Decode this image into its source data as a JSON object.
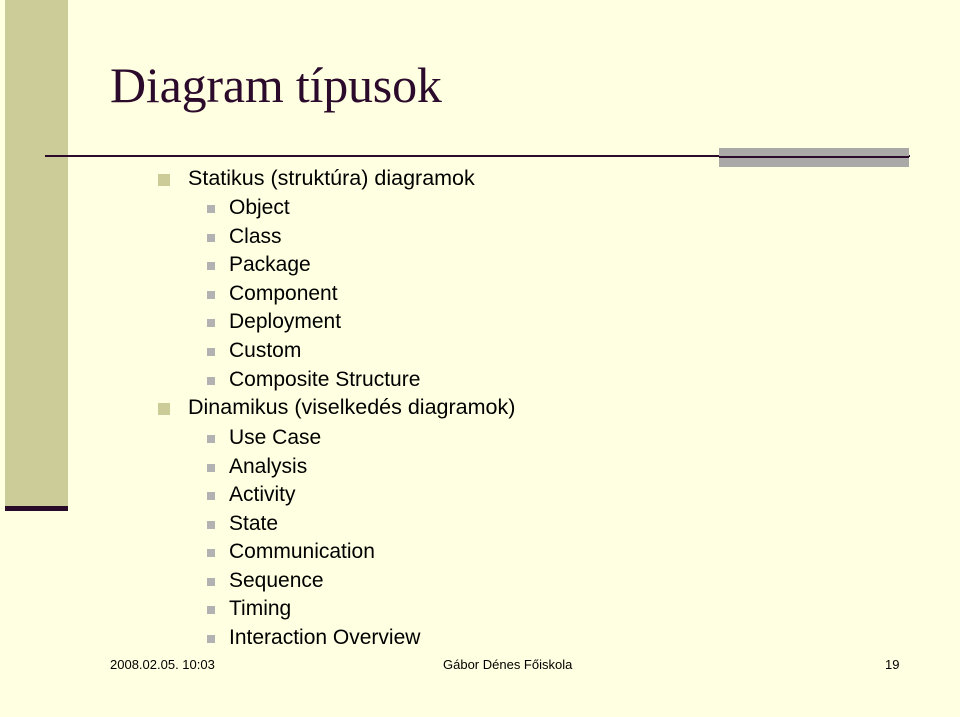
{
  "slide": {
    "title": "Diagram típusok",
    "sections": [
      {
        "label": "Statikus (struktúra) diagramok",
        "items": [
          "Object",
          "Class",
          "Package",
          "Component",
          "Deployment",
          "Custom",
          "Composite Structure"
        ]
      },
      {
        "label": "Dinamikus (viselkedés diagramok)",
        "items": [
          "Use Case",
          "Analysis",
          "Activity",
          "State",
          "Communication",
          "Sequence",
          "Timing",
          "Interaction Overview"
        ]
      }
    ],
    "footer": {
      "date": "2008.02.05. 10:03",
      "organization": "Gábor Dénes Főiskola",
      "page_number": "19"
    },
    "colors": {
      "background": "#FFFFE1",
      "accent_bar": "#CCCC99",
      "title": "#2B0A2B",
      "level2_bullet": "#B2B2B2"
    }
  }
}
